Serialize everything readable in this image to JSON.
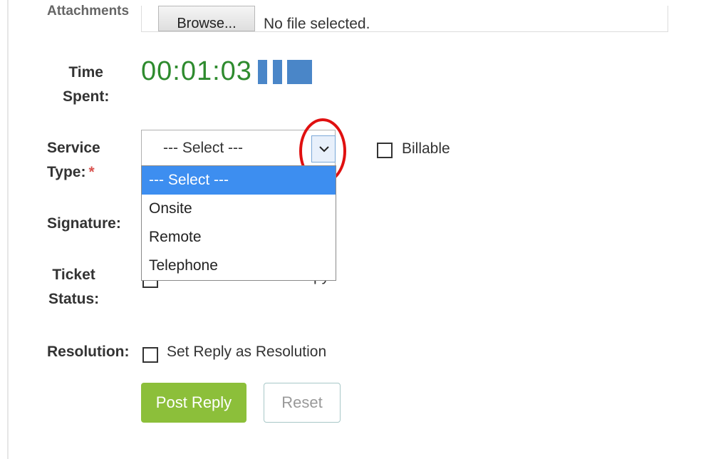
{
  "attachments": {
    "label": "Attachments",
    "browse_label": "Browse...",
    "file_status": "No file selected."
  },
  "time_spent": {
    "label_line1": "Time",
    "label_line2": "Spent:",
    "value": "00:01:03"
  },
  "service_type": {
    "label_line1": "Service",
    "label_line2": "Type:",
    "required_mark": "*",
    "selected": "--- Select ---",
    "options": [
      "--- Select ---",
      "Onsite",
      "Remote",
      "Telephone"
    ]
  },
  "billable": {
    "label": "Billable"
  },
  "signature": {
    "label": "Signature:"
  },
  "ticket_status": {
    "label_line1": "Ticket",
    "label_line2": "Status:",
    "partial_text": "py"
  },
  "resolution": {
    "label": "Resolution:",
    "checkbox_label": "Set Reply as Resolution"
  },
  "actions": {
    "post_label": "Post Reply",
    "reset_label": "Reset"
  },
  "colors": {
    "timer": "#2e8b2e",
    "post_button": "#8cbf3a",
    "highlight": "#3d8ef0",
    "annotation": "#e01010"
  }
}
